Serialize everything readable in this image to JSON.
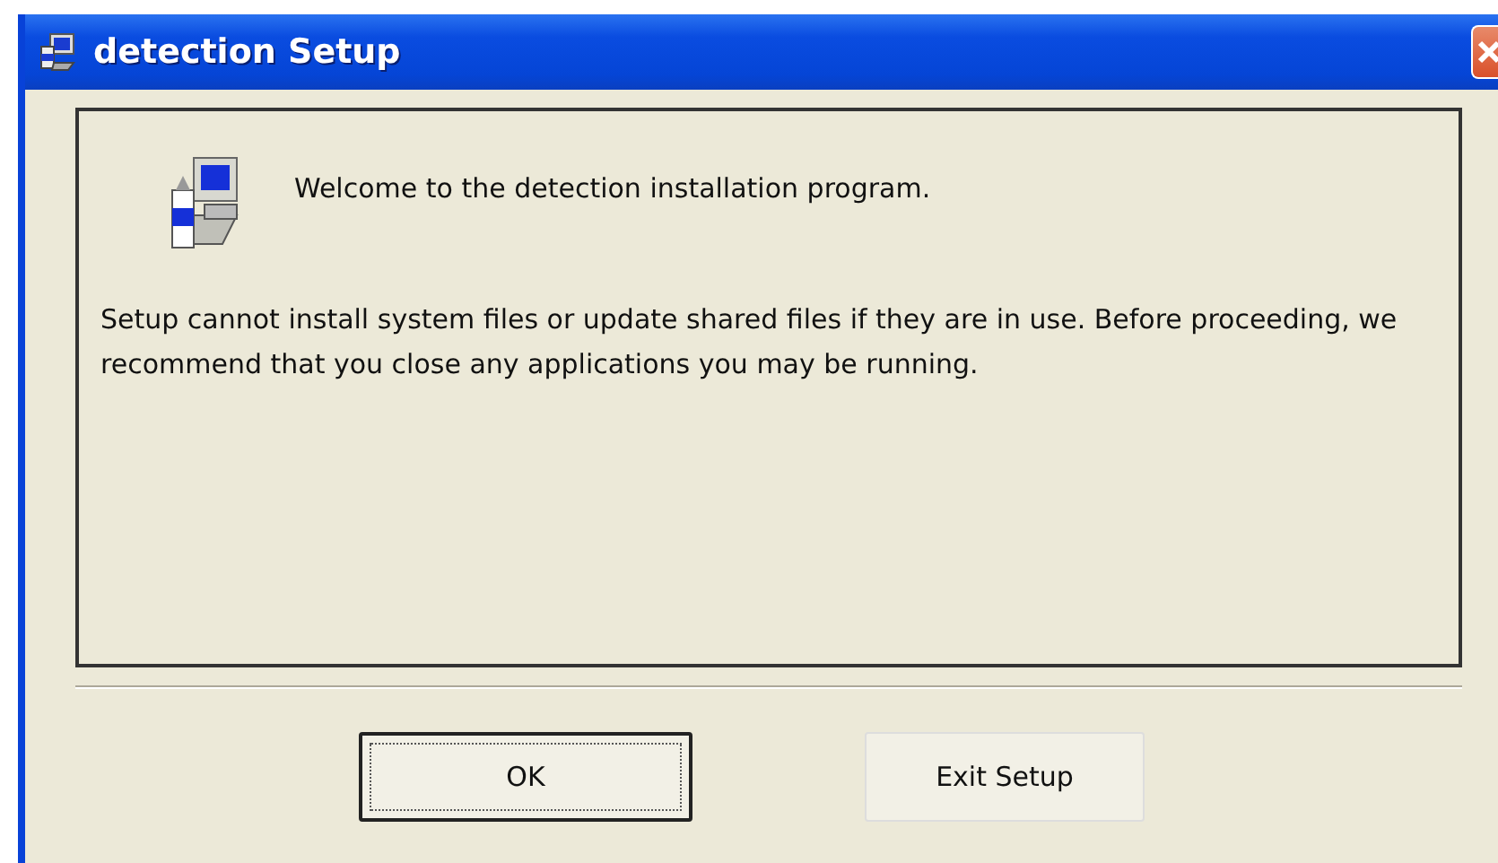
{
  "window": {
    "title": "detection Setup"
  },
  "welcome": "Welcome to the detection installation program.",
  "message": "Setup cannot install system files or update shared files if they are in use. Before proceeding, we recommend that you close any applications you may be running.",
  "buttons": [
    {
      "label": "OK",
      "focused": true
    },
    {
      "label": "Exit Setup",
      "focused": false
    }
  ]
}
